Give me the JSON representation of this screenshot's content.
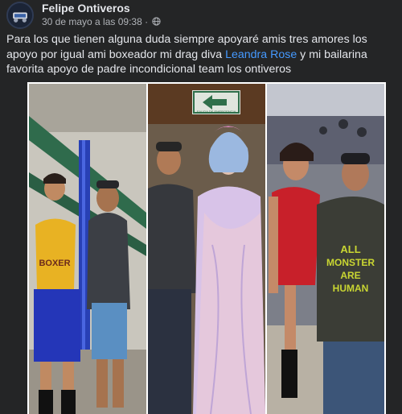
{
  "post": {
    "author": "Felipe Ontiveros",
    "timestamp": "30 de mayo a las 09:38",
    "separator": "·",
    "privacy_icon": "globe-icon",
    "text_before": "Para los que tienen alguna duda siempre apoyaré amis tres amores los apoyo por igual ami boxeador mi drag diva ",
    "mention": "Leandra Rose",
    "text_after": " y mi bailarina favorita apoyo de padre incondicional team los ontiveros"
  },
  "photo": {
    "sign_text": "SALIDA DE EMERGENCIA",
    "shirt_text_1": "BOXER",
    "shirt_text_2": "ALL",
    "shirt_text_3": "MONSTER",
    "shirt_text_4": "ARE",
    "shirt_text_5": "HUMAN"
  },
  "colors": {
    "background": "#242526",
    "text": "#e4e6eb",
    "secondary_text": "#b0b3b8",
    "link": "#4599ff"
  }
}
